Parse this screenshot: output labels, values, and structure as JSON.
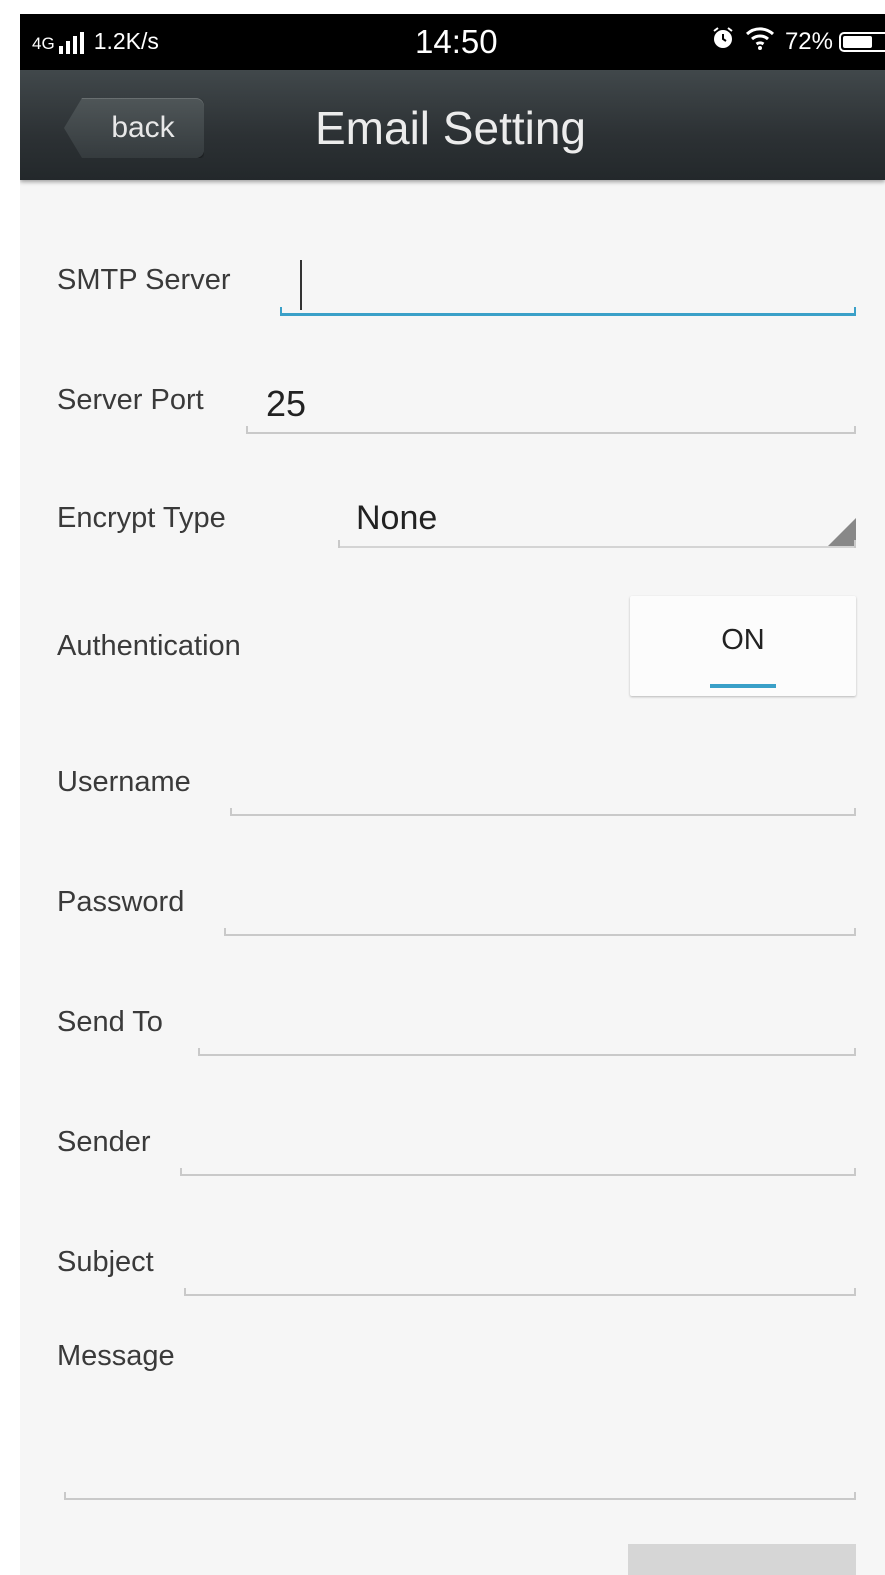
{
  "status_bar": {
    "network": "4G",
    "speed": "1.2K/s",
    "time": "14:50",
    "battery": "72%",
    "battery_level": 0.72,
    "icons": [
      "signal-icon",
      "alarm-icon",
      "wifi-icon",
      "battery-icon"
    ]
  },
  "nav": {
    "back_label": "back",
    "title": "Email Setting"
  },
  "form": {
    "smtp_server": {
      "label": "SMTP Server",
      "value": ""
    },
    "server_port": {
      "label": "Server Port",
      "value": "25"
    },
    "encrypt_type": {
      "label": "Encrypt Type",
      "value": "None"
    },
    "authentication": {
      "label": "Authentication",
      "value": "ON"
    },
    "username": {
      "label": "Username",
      "value": ""
    },
    "password": {
      "label": "Password",
      "value": ""
    },
    "send_to": {
      "label": "Send To",
      "value": ""
    },
    "sender": {
      "label": "Sender",
      "value": ""
    },
    "subject": {
      "label": "Subject",
      "value": ""
    },
    "message": {
      "label": "Message",
      "value": ""
    }
  },
  "colors": {
    "accent": "#3aa0c8",
    "nav_bar": "#2c3134",
    "background": "#f6f6f6"
  }
}
